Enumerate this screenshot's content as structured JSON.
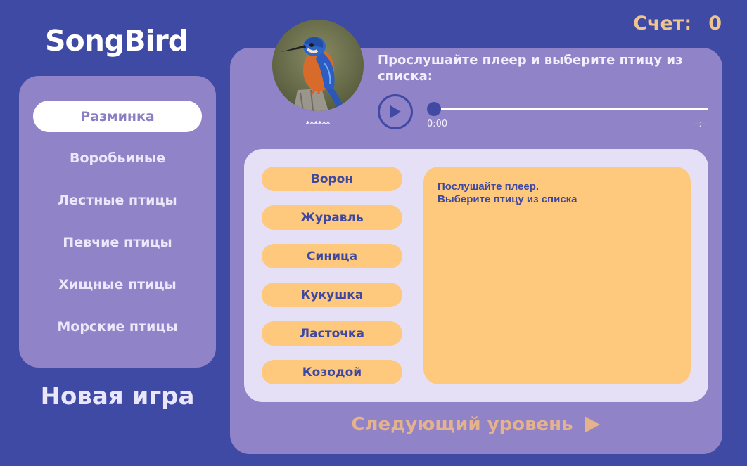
{
  "app": {
    "logo": "SongBird"
  },
  "score": {
    "label": "Счет:",
    "value": "0"
  },
  "sidebar": {
    "items": [
      {
        "label": "Разминка",
        "active": true
      },
      {
        "label": "Воробьиные",
        "active": false
      },
      {
        "label": "Лестные птицы",
        "active": false
      },
      {
        "label": "Певчие птицы",
        "active": false
      },
      {
        "label": "Хищные птицы",
        "active": false
      },
      {
        "label": "Морские птицы",
        "active": false
      }
    ],
    "new_game": "Новая игра"
  },
  "question": {
    "hidden_name": "******",
    "prompt": "Прослушайте плеер и выберите птицу из списка:",
    "player": {
      "current_time": "0:00",
      "duration": "--:--",
      "progress": 0
    }
  },
  "options": [
    "Ворон",
    "Журавль",
    "Синица",
    "Кукушка",
    "Ласточка",
    "Козодой"
  ],
  "info": {
    "line1": "Послушайте плеер.",
    "line2": "Выберите птицу из списка"
  },
  "next_level": {
    "label": "Следующий уровень"
  },
  "colors": {
    "background": "#3f4aa4",
    "panel": "#9183c7",
    "option": "#fec87d",
    "score": "#f0c58d",
    "next_level": "#e4b28c"
  },
  "icons": {
    "play": "play-icon",
    "next": "arrow-right-icon",
    "bird": "kingfisher-photo"
  }
}
